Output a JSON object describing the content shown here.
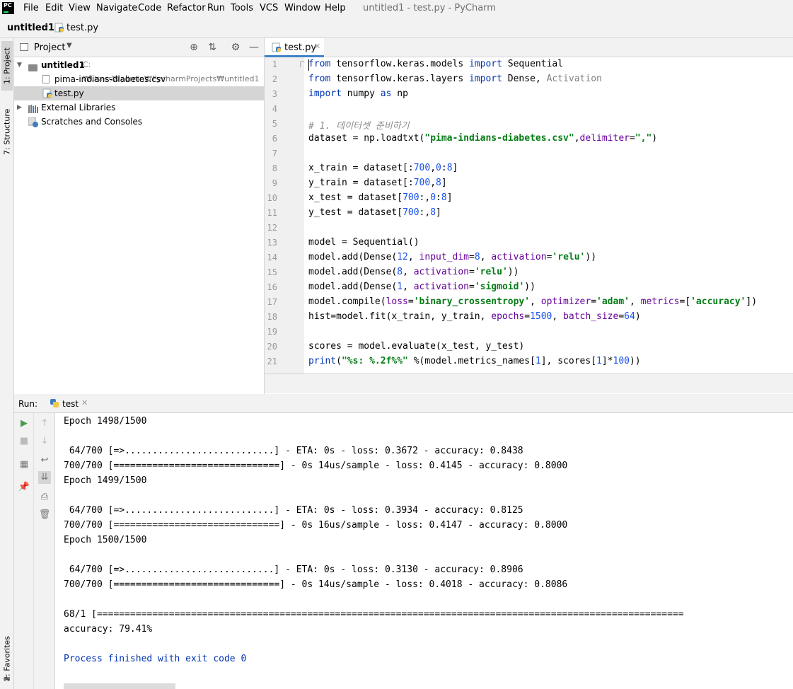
{
  "app": {
    "logo_text": "PC",
    "menu": [
      "File",
      "Edit",
      "View",
      "Navigate",
      "Code",
      "Refactor",
      "Run",
      "Tools",
      "VCS",
      "Window",
      "Help"
    ],
    "window_title": "untitled1 - test.py - PyCharm"
  },
  "navbar": {
    "project": "untitled1",
    "separator": "›",
    "file": "test.py"
  },
  "tool_stripe": {
    "project": "1: Project",
    "structure": "7: Structure",
    "favorites": "2: Favorites"
  },
  "project_panel": {
    "title": "Project",
    "tree": [
      {
        "name": "untitled1",
        "path": "C:₩Users₩admin₩PycharmProjects₩untitled1"
      },
      {
        "name": "pima-indians-diabetes.csv"
      },
      {
        "name": "test.py"
      },
      {
        "name": "External Libraries"
      },
      {
        "name": "Scratches and Consoles"
      }
    ]
  },
  "editor": {
    "tab": "test.py",
    "line_numbers": [
      "1",
      "2",
      "3",
      "4",
      "5",
      "6",
      "7",
      "8",
      "9",
      "10",
      "11",
      "12",
      "13",
      "14",
      "15",
      "16",
      "17",
      "18",
      "19",
      "20",
      "21"
    ]
  },
  "run": {
    "label": "Run:",
    "tab": "test",
    "console": [
      {
        "text": "Epoch 1498/1500"
      },
      {
        "text": ""
      },
      {
        "text": " 64/700 [=>...........................] - ETA: 0s - loss: 0.3672 - accuracy: 0.8438"
      },
      {
        "text": "700/700 [==============================] - 0s 14us/sample - loss: 0.4145 - accuracy: 0.8000"
      },
      {
        "text": "Epoch 1499/1500"
      },
      {
        "text": ""
      },
      {
        "text": " 64/700 [=>...........................] - ETA: 0s - loss: 0.3934 - accuracy: 0.8125"
      },
      {
        "text": "700/700 [==============================] - 0s 16us/sample - loss: 0.4147 - accuracy: 0.8000"
      },
      {
        "text": "Epoch 1500/1500"
      },
      {
        "text": ""
      },
      {
        "text": " 64/700 [=>...........................] - ETA: 0s - loss: 0.3130 - accuracy: 0.8906"
      },
      {
        "text": "700/700 [==============================] - 0s 14us/sample - loss: 0.4018 - accuracy: 0.8086"
      },
      {
        "text": ""
      },
      {
        "text": "68/1 [=========================================================================================================="
      },
      {
        "text": "accuracy: 79.41%"
      },
      {
        "text": ""
      },
      {
        "text": "Process finished with exit code 0"
      }
    ]
  }
}
